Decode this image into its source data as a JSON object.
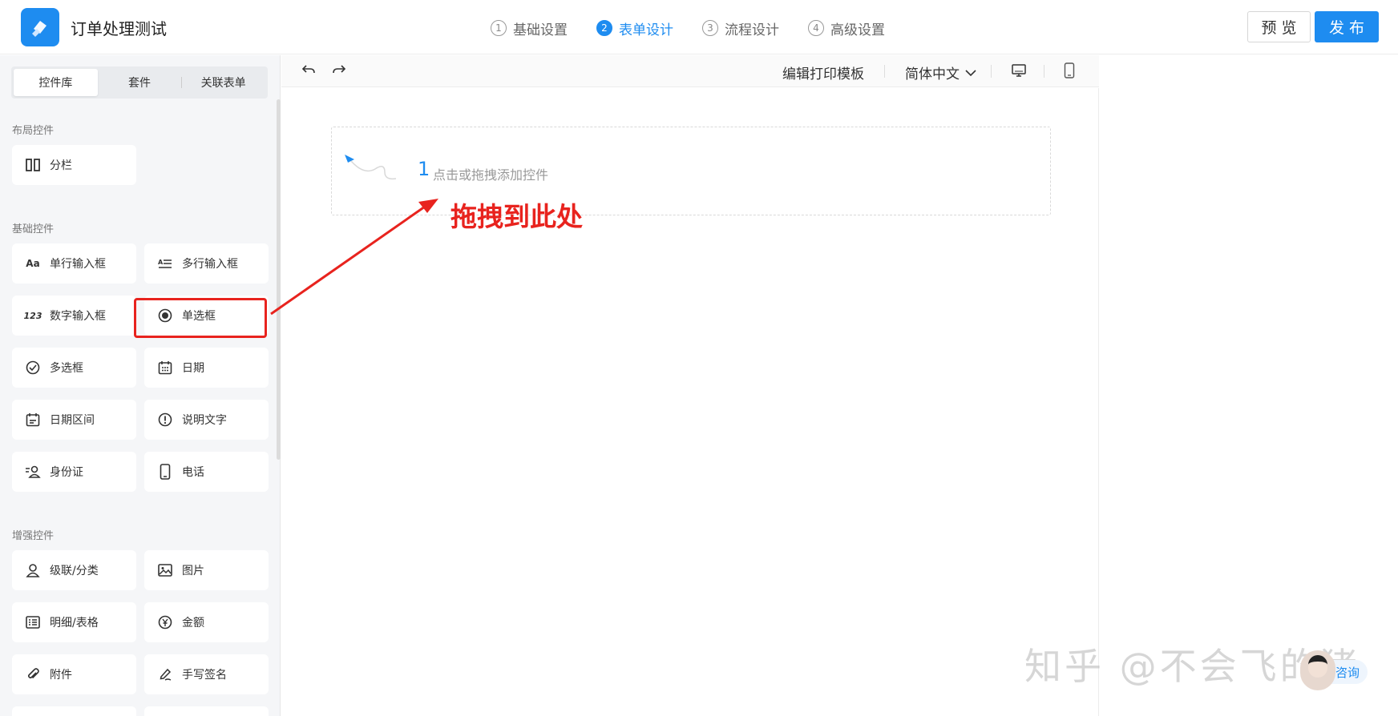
{
  "header": {
    "app_title": "订单处理测试",
    "steps": [
      {
        "num": "1",
        "label": "基础设置"
      },
      {
        "num": "2",
        "label": "表单设计"
      },
      {
        "num": "3",
        "label": "流程设计"
      },
      {
        "num": "4",
        "label": "高级设置"
      }
    ],
    "active_step": 2,
    "preview_label": "预 览",
    "publish_label": "发 布",
    "accent_color": "#1e8cf0"
  },
  "left_panel": {
    "tabs": [
      "控件库",
      "套件",
      "关联表单"
    ],
    "active_tab": 0,
    "sections": {
      "layout": {
        "title": "布局控件",
        "items": [
          "分栏"
        ]
      },
      "basic": {
        "title": "基础控件",
        "items": [
          "单行输入框",
          "多行输入框",
          "数字输入框",
          "单选框",
          "多选框",
          "日期",
          "日期区间",
          "说明文字",
          "身份证",
          "电话"
        ]
      },
      "enhanced": {
        "title": "增强控件",
        "items": [
          "级联/分类",
          "图片",
          "明细/表格",
          "金额",
          "附件",
          "手写签名"
        ]
      }
    },
    "highlighted_item": "单选框",
    "highlight_color": "#e8231e"
  },
  "toolbar": {
    "print_template": "编辑打印模板",
    "language": "简体中文"
  },
  "canvas": {
    "dropzone_number": "1",
    "dropzone_hint": "点击或拖拽添加控件",
    "annotation": "拖拽到此处"
  },
  "watermark": "知乎 @不会飞的猪",
  "consult_label": "咨询"
}
